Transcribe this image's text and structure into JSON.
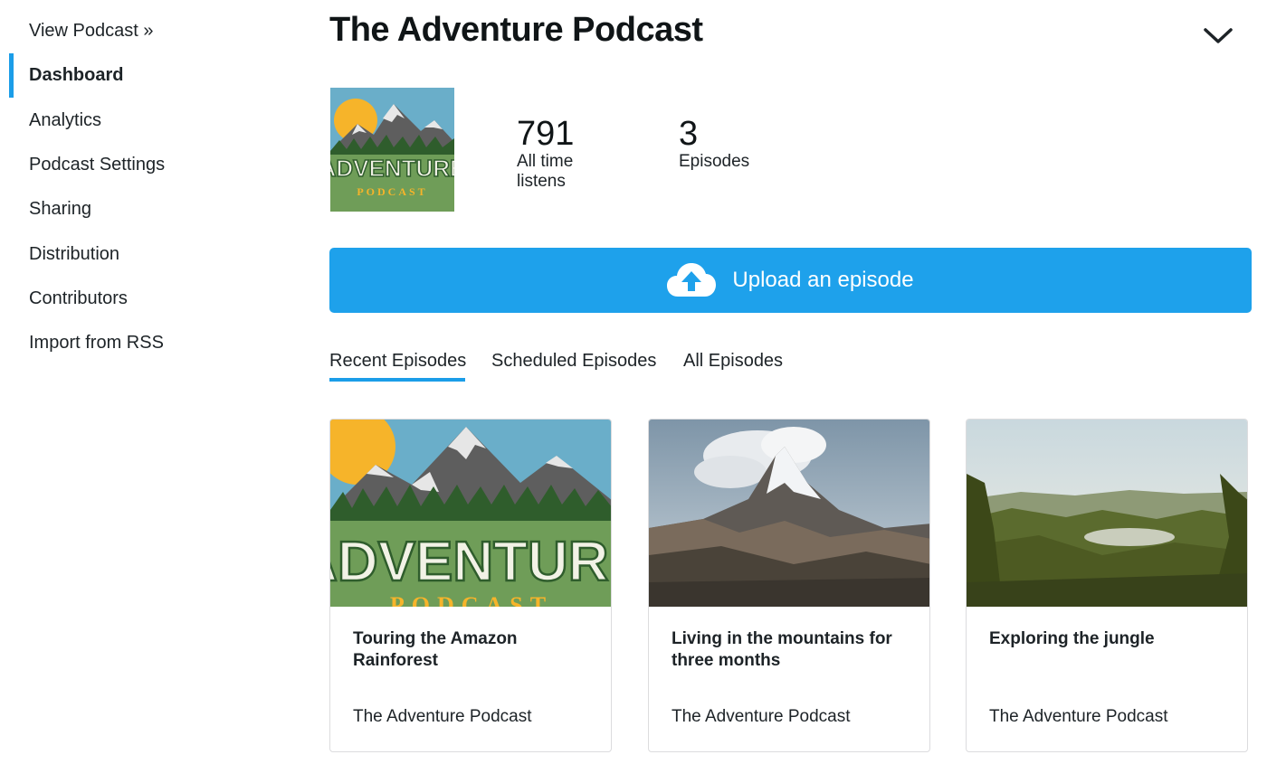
{
  "sidebar": {
    "items": [
      {
        "label": "View Podcast »"
      },
      {
        "label": "Dashboard",
        "active": true
      },
      {
        "label": "Analytics"
      },
      {
        "label": "Podcast Settings"
      },
      {
        "label": "Sharing"
      },
      {
        "label": "Distribution"
      },
      {
        "label": "Contributors"
      },
      {
        "label": "Import from RSS"
      }
    ]
  },
  "header": {
    "title": "The Adventure Podcast",
    "dropdown_icon": "chevron-down-icon"
  },
  "podcast": {
    "cover_title": "ADVENTURE",
    "cover_subtitle": "PODCAST"
  },
  "stats": {
    "listens_value": "791",
    "listens_label_line1": "All time",
    "listens_label_line2": "listens",
    "episodes_value": "3",
    "episodes_label": "Episodes"
  },
  "upload": {
    "label": "Upload an episode",
    "icon": "cloud-upload-icon"
  },
  "tabs": [
    {
      "label": "Recent Episodes",
      "active": true
    },
    {
      "label": "Scheduled Episodes"
    },
    {
      "label": "All Episodes"
    }
  ],
  "episodes": [
    {
      "title": "Touring the Amazon Rainforest",
      "podcast": "The Adventure Podcast",
      "image": "adventure-cover"
    },
    {
      "title": "Living in the mountains for three months",
      "podcast": "The Adventure Podcast",
      "image": "mountain-photo"
    },
    {
      "title": "Exploring the jungle",
      "podcast": "The Adventure Podcast",
      "image": "jungle-photo"
    }
  ],
  "colors": {
    "accent": "#1ea1eb",
    "text": "#1d2327",
    "border": "#dcdcde"
  }
}
